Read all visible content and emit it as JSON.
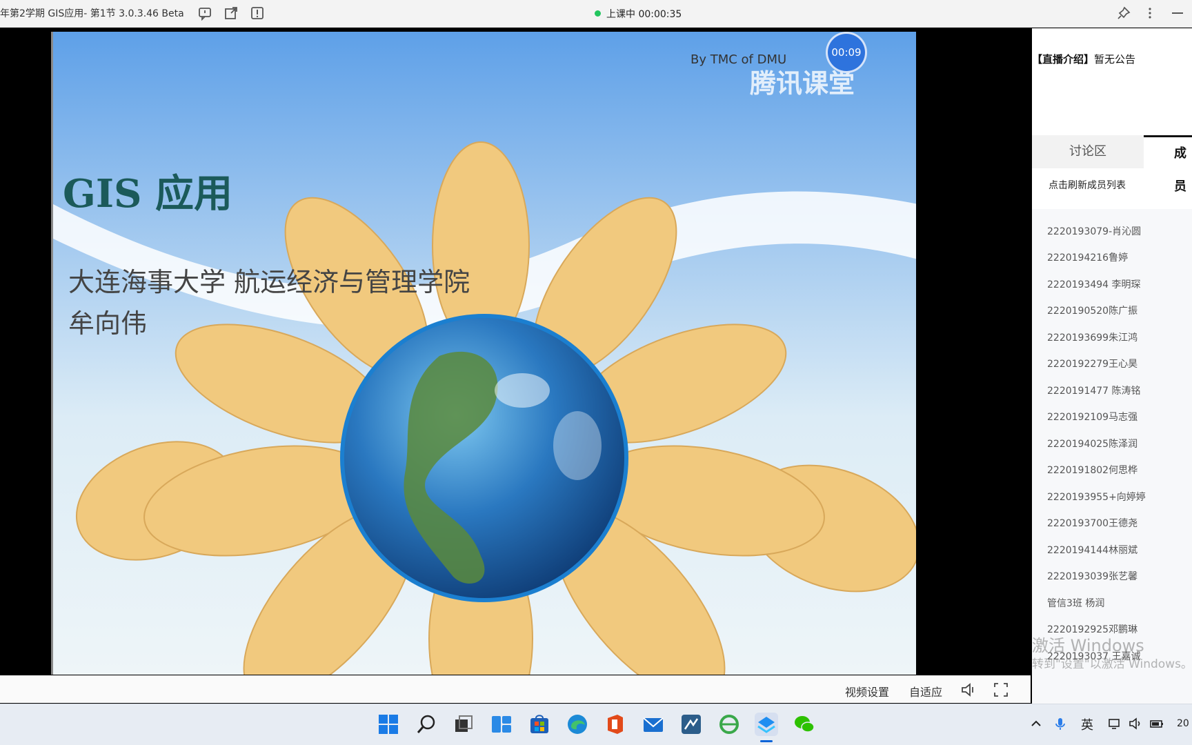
{
  "titlebar": {
    "title": "年第2学期 GIS应用- 第1节 3.0.3.46 Beta",
    "status_text": "上课中 00:00:35"
  },
  "slide": {
    "by_text": "By  TMC of DMU",
    "logo_text": "腾讯课堂",
    "timer": "00:09",
    "title": "GIS  应用",
    "subtitle_line1": "大连海事大学  航运经济与管理学院",
    "subtitle_line2": "牟向伟"
  },
  "controls": {
    "video_settings": "视频设置",
    "fit_mode": "自适应"
  },
  "sidebar": {
    "notice_label": "【直播介绍】",
    "notice_text": "暂无公告",
    "tabs": [
      {
        "label": "讨论区"
      },
      {
        "label": "成员"
      }
    ],
    "refresh_label": "点击刷新成员列表",
    "members": [
      "2220193079-肖沁圆",
      "2220194216鲁婷",
      "2220193494 李明琛",
      "2220190520陈广振",
      "2220193699朱江鸿",
      "2220192279王心昊",
      "2220191477 陈涛铭",
      "2220192109马志强",
      "2220194025陈泽润",
      "2220191802何思桦",
      "2220193955+向婷婷",
      "2220193700王德尧",
      "2220194144林丽斌",
      "2220193039张艺馨",
      "管信3班 杨润",
      "2220192925邓鹏琳",
      "2220193037 王嘉诚"
    ]
  },
  "os_watermark": {
    "line1": "激活 Windows",
    "line2": "转到\"设置\"以激活 Windows。"
  },
  "taskbar": {
    "ime": "英",
    "clock_partial": "20"
  }
}
